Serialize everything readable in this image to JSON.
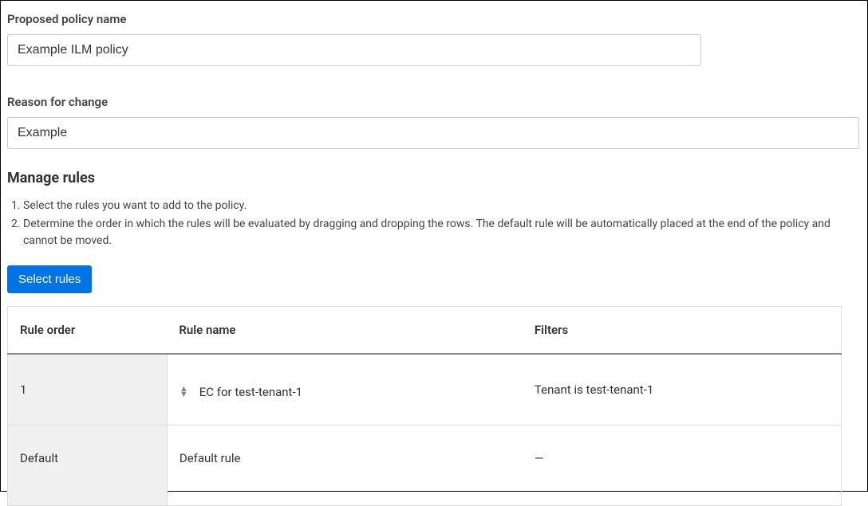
{
  "policyName": {
    "label": "Proposed policy name",
    "value": "Example ILM policy"
  },
  "reasonForChange": {
    "label": "Reason for change",
    "value": "Example"
  },
  "manageRules": {
    "heading": "Manage rules",
    "instructions": [
      "Select the rules you want to add to the policy.",
      "Determine the order in which the rules will be evaluated by dragging and dropping the rows. The default rule will be automatically placed at the end of the policy and cannot be moved."
    ],
    "selectRulesLabel": "Select rules",
    "columns": {
      "order": "Rule order",
      "name": "Rule name",
      "filters": "Filters"
    },
    "rows": [
      {
        "order": "1",
        "name": "EC for test-tenant-1",
        "filters": "Tenant is test-tenant-1",
        "draggable": true
      },
      {
        "order": "Default",
        "name": "Default rule",
        "filters": "—",
        "draggable": false
      }
    ]
  }
}
